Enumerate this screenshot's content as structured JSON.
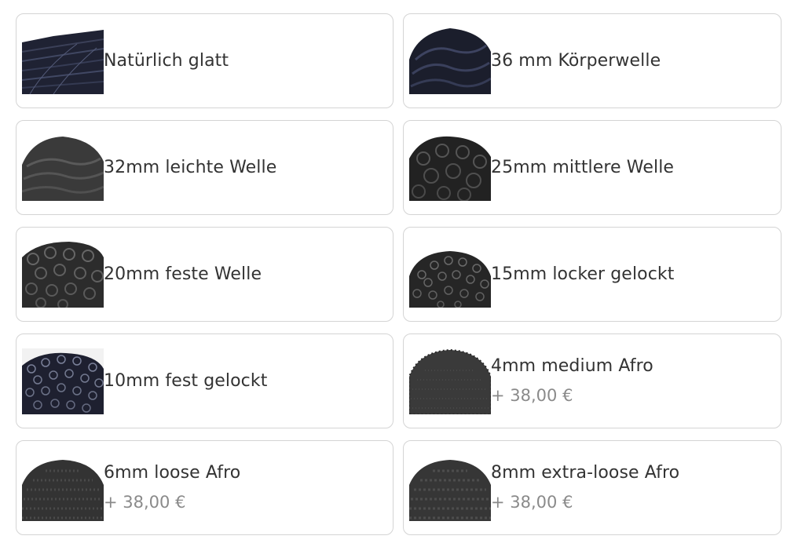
{
  "options": [
    {
      "label": "Natürlich glatt",
      "price": "",
      "image": "straight-hair-swatch"
    },
    {
      "label": "36 mm Körperwelle",
      "price": "",
      "image": "body-wave-hair-swatch"
    },
    {
      "label": "32mm leichte Welle",
      "price": "",
      "image": "slight-wave-hair-swatch"
    },
    {
      "label": "25mm mittlere Welle",
      "price": "",
      "image": "medium-wave-hair-swatch"
    },
    {
      "label": "20mm feste Welle",
      "price": "",
      "image": "firm-wave-hair-swatch"
    },
    {
      "label": "15mm locker gelockt",
      "price": "",
      "image": "loose-curl-hair-swatch"
    },
    {
      "label": "10mm fest gelockt",
      "price": "",
      "image": "tight-curl-hair-swatch"
    },
    {
      "label": "4mm medium Afro",
      "price": "+ 38,00 €",
      "image": "afro-hair-swatch"
    },
    {
      "label": "6mm loose Afro",
      "price": "+ 38,00 €",
      "image": "afro-hair-swatch"
    },
    {
      "label": "8mm extra-loose Afro",
      "price": "+ 38,00 €",
      "image": "afro-hair-swatch"
    }
  ],
  "colors": {
    "border": "#d4d4d4",
    "text": "#333333",
    "price": "#8a8a8a"
  }
}
